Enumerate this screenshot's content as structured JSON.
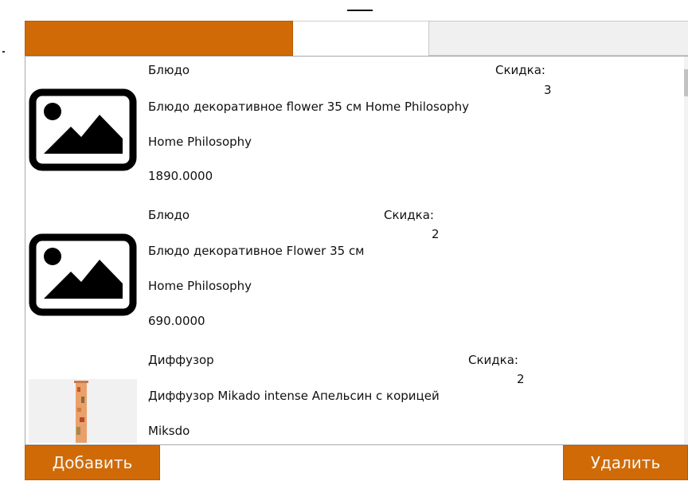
{
  "products": [
    {
      "category": "Блюдо",
      "name": "Блюдо декоративное flower 35 см Home Philosophy",
      "manufacturer": "Home Philosophy",
      "price": "1890.0000",
      "discount_label": "Скидка:",
      "discount_value": "3",
      "image": "image-placeholder-icon"
    },
    {
      "category": "Блюдо",
      "name": "Блюдо декоративное Flower 35 см",
      "manufacturer": "Home Philosophy",
      "price": "690.0000",
      "discount_label": "Скидка:",
      "discount_value": "2",
      "image": "image-placeholder-icon"
    },
    {
      "category": "Диффузор",
      "name": "Диффузор Mikado intense Апельсин с корицей",
      "manufacturer": "Miksdo",
      "price": "",
      "discount_label": "Скидка:",
      "discount_value": "2",
      "image": "diffuser-photo"
    }
  ],
  "buttons": {
    "add": "Добавить",
    "delete": "Удалить"
  },
  "colors": {
    "accent": "#d06a07",
    "text": "#111111",
    "button_text": "#f6f6f6"
  }
}
